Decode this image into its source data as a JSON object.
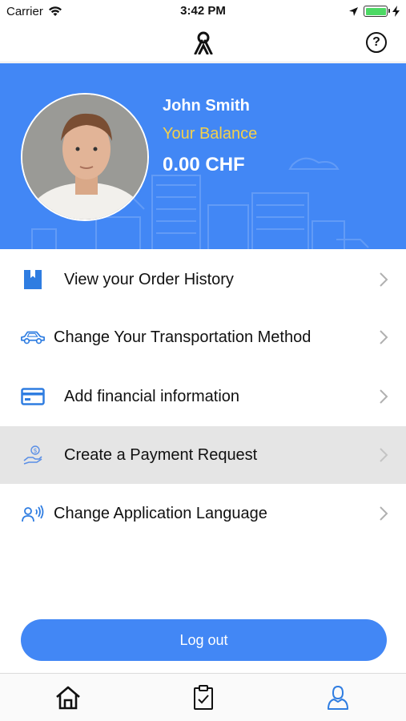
{
  "status_bar": {
    "carrier": "Carrier",
    "time": "3:42 PM"
  },
  "nav": {
    "help_label": "?"
  },
  "profile": {
    "name": "John Smith",
    "balance_label": "Your Balance",
    "balance_value": "0.00 CHF"
  },
  "menu": [
    {
      "label": "View your Order History",
      "icon": "bookmark-icon"
    },
    {
      "label": "Change Your Transportation Method",
      "icon": "car-icon"
    },
    {
      "label": "Add financial information",
      "icon": "credit-card-icon"
    },
    {
      "label": "Create a Payment Request",
      "icon": "hand-money-icon"
    },
    {
      "label": "Change Application Language",
      "icon": "voice-person-icon"
    }
  ],
  "logout_label": "Log out",
  "tabs": [
    {
      "name": "home",
      "icon": "home-icon"
    },
    {
      "name": "orders",
      "icon": "clipboard-check-icon"
    },
    {
      "name": "profile",
      "icon": "user-icon",
      "active": true
    }
  ],
  "colors": {
    "accent": "#4287f5",
    "balance_label": "#f4d04a",
    "highlight_row": "#e5e5e5"
  }
}
